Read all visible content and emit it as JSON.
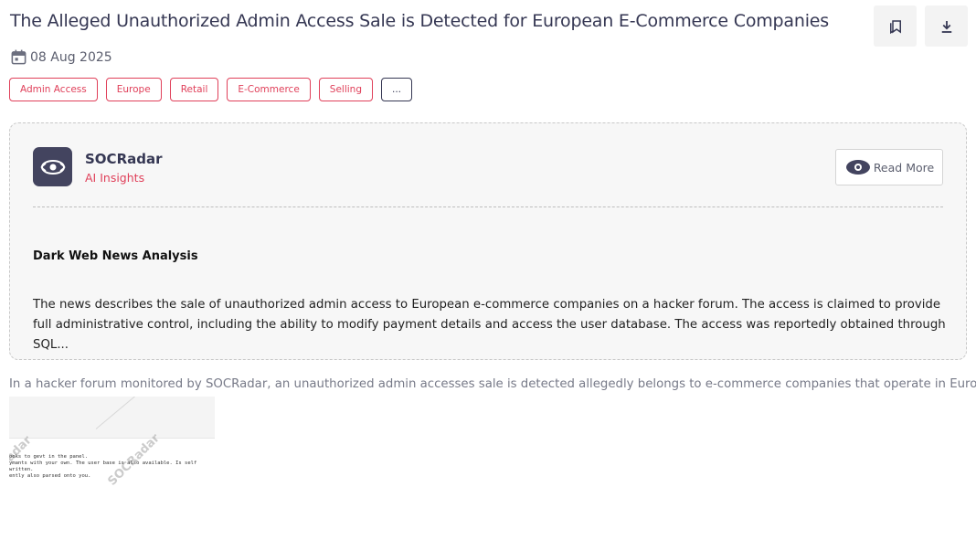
{
  "article": {
    "title": "The Alleged Unauthorized Admin Access Sale is Detected for European E-Commerce Companies",
    "date": "08 Aug 2025",
    "tags": [
      "Admin Access",
      "Europe",
      "Retail",
      "E-Commerce",
      "Selling"
    ],
    "more_tags_label": "...",
    "summary": "In a hacker forum monitored by SOCRadar, an unauthorized admin accesses sale is detected allegedly belongs to e-commerce companies that operate in Europe."
  },
  "actions": {
    "bookmark_icon": "bookmark-icon",
    "download_icon": "download-icon"
  },
  "insights": {
    "brand": "SOCRadar",
    "subtitle": "AI Insights",
    "read_more_label": "Read More",
    "section_title": "Dark Web News Analysis",
    "body": "The news describes the sale of unauthorized admin access to European e-commerce companies on a hacker forum. The access is claimed to provide full administrative control, including the ability to modify payment details and access the user database. The access was reportedly obtained through SQL..."
  },
  "thumbnail": {
    "watermark": "SOCRadar",
    "watermark_partial": "adar",
    "lines": [
      "ooks to gevt in the panel.",
      "ymants with your own. The user base is also available. Is self written.",
      "ently also parsed onto you."
    ]
  },
  "colors": {
    "accent": "#e0405a",
    "brand_dark": "#353753",
    "logo_bg": "#43445f"
  }
}
